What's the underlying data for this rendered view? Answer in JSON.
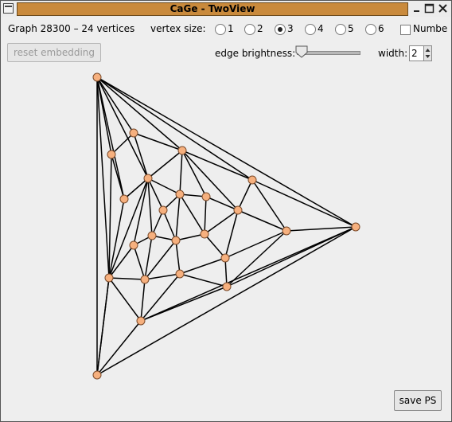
{
  "window": {
    "title": "CaGe - TwoView"
  },
  "toolbar": {
    "graph_label": "Graph 28300 – 24 vertices",
    "vertex_size_label": "vertex size:",
    "vertex_size_options": [
      "1",
      "2",
      "3",
      "4",
      "5",
      "6"
    ],
    "vertex_size_selected": "3",
    "numbers_label": "Numbe",
    "numbers_checked": false,
    "reset_label": "reset embedding",
    "edge_brightness_label": "edge brightness:",
    "edge_brightness_value": 0,
    "width_label": "width:",
    "width_value": "2",
    "save_label": "save PS"
  },
  "graph": {
    "vertex_count": 24,
    "vertex_color": "#f6b07e",
    "vertex_stroke": "#7a4a2a",
    "edge_color": "#000000"
  }
}
